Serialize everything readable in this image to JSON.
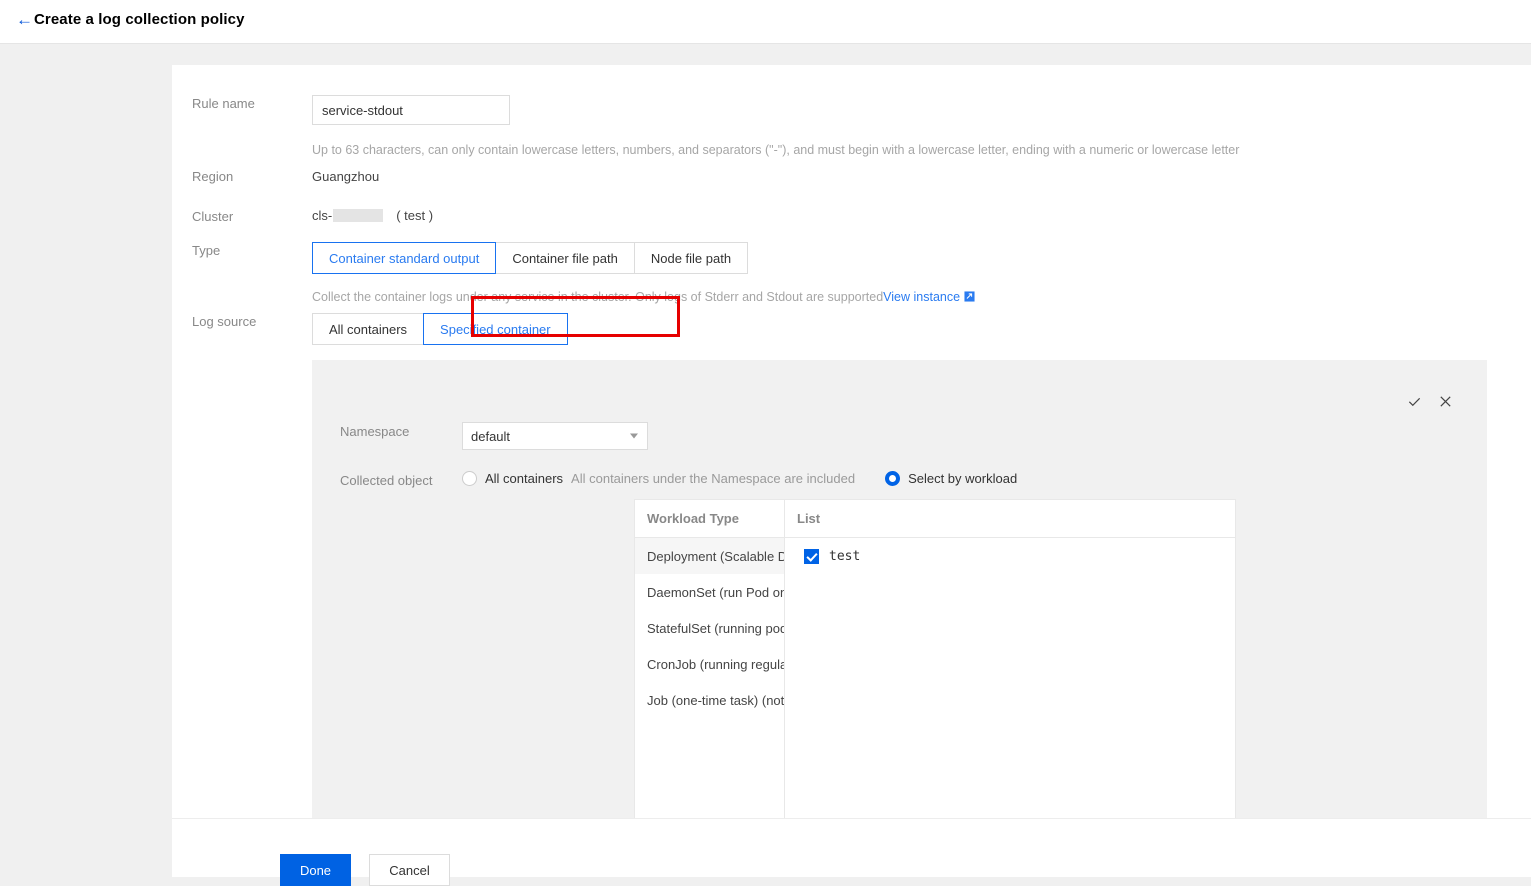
{
  "header": {
    "back_icon": "arrow-left-icon",
    "title": "Create a log collection policy"
  },
  "form": {
    "rule_name": {
      "label": "Rule name",
      "value": "service-stdout",
      "placeholder": "",
      "hint": "Up to 63 characters, can only contain lowercase letters, numbers, and separators (\"-\"), and must begin with a lowercase letter, ending with a numeric or lowercase letter"
    },
    "region": {
      "label": "Region",
      "value": "Guangzhou"
    },
    "cluster": {
      "label": "Cluster",
      "prefix": "cls-",
      "suffix": "( test )"
    },
    "type": {
      "label": "Type",
      "options": [
        "Container standard output",
        "Container file path",
        "Node file path"
      ],
      "selected": "Container standard output",
      "description": "Collect the container logs under any service in the cluster. Only logs of Stderr and Stdout are supported",
      "link_text": "View instance",
      "link_icon": "external-link-icon"
    },
    "log_source": {
      "label": "Log source",
      "options": [
        "All containers",
        "Specified container"
      ],
      "selected": "Specified container"
    }
  },
  "subpanel": {
    "confirm_icon": "check-icon",
    "cancel_icon": "close-icon",
    "namespace": {
      "label": "Namespace",
      "value": "default",
      "caret_icon": "chevron-down-icon"
    },
    "collected_object": {
      "label": "Collected object",
      "all_containers_label": "All containers",
      "all_containers_note": "All containers under the Namespace are included",
      "all_containers_selected": false,
      "select_by_workload_label": "Select by workload",
      "select_by_workload_selected": true
    },
    "table": {
      "headers": [
        "Workload Type",
        "List"
      ],
      "workload_types": [
        {
          "label": "Deployment (Scalable D...",
          "selected": true
        },
        {
          "label": "DaemonSet (run Pod on ...",
          "selected": false
        },
        {
          "label": "StatefulSet (running pod...",
          "selected": false
        },
        {
          "label": "CronJob (running regula...",
          "selected": false
        },
        {
          "label": "Job (one-time task) (not ...",
          "selected": false
        }
      ],
      "list_items": [
        {
          "label": "test",
          "checked": true
        }
      ]
    }
  },
  "footer": {
    "done_label": "Done",
    "cancel_label": "Cancel"
  },
  "colors": {
    "accent": "#0062e3",
    "link": "#2a7bf0",
    "annotation": "#e60000",
    "page_bg": "#f0f0f0",
    "panel_bg": "#f1f1f1"
  }
}
